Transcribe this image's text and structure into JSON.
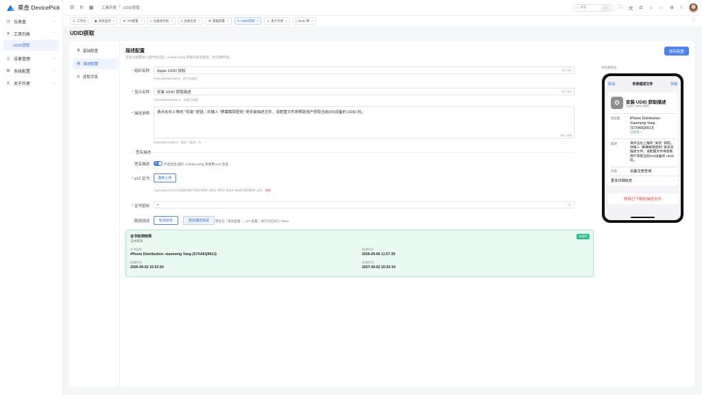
{
  "brand": {
    "name": "乘查 DevicePick"
  },
  "sidebar": {
    "items": [
      {
        "label": "仪表盘",
        "icon": "dashboard-icon",
        "glyph": "◷"
      },
      {
        "label": "工具列表",
        "icon": "tools-icon",
        "glyph": "✕"
      },
      {
        "label": "设备管理",
        "icon": "device-icon",
        "glyph": "▯"
      },
      {
        "label": "系统配置",
        "icon": "settings-icon",
        "glyph": "⚙"
      },
      {
        "label": "关于作者",
        "icon": "user-icon",
        "glyph": "♙"
      }
    ],
    "sub_item": "UDID获取"
  },
  "header": {
    "breadcrumb": [
      "工具列表",
      "UDID获取"
    ],
    "search_placeholder": "搜索",
    "search_shortcut": "⌘ K"
  },
  "tabs": [
    {
      "label": "工作台",
      "glyph": "◷",
      "closable": false
    },
    {
      "label": "系统监控",
      "glyph": "▣",
      "closable": true
    },
    {
      "label": "API配置",
      "glyph": "⚙",
      "closable": true
    },
    {
      "label": "设备组识别",
      "glyph": "▯",
      "closable": true
    },
    {
      "label": "设备信息",
      "glyph": "▯",
      "closable": true
    },
    {
      "label": "基础配置",
      "glyph": "⚙",
      "closable": true
    },
    {
      "label": "UDID获取",
      "glyph": "✕",
      "closable": true,
      "active": true
    },
    {
      "label": "关于作者",
      "glyph": "♙",
      "closable": true
    },
    {
      "label": "Bx3d 尊",
      "glyph": "▯",
      "closable": true
    }
  ],
  "page": {
    "title": "UDID获取"
  },
  "subnav": [
    {
      "label": "基础配置",
      "glyph": "⚙"
    },
    {
      "label": "描述配置",
      "glyph": "▤",
      "active": true
    },
    {
      "label": "提取字段",
      "glyph": "◎"
    }
  ],
  "form": {
    "section_title": "描述配置",
    "section_desc": "自定义配置导入后时生成的 .mobileconfig 的额外安装预览，所见即所得。",
    "save_label": "保存配置",
    "org_label": "组织名称",
    "org_value": "Apple UDID 授权",
    "org_count": "13 / 64",
    "org_hint": "PayloadOrganization · 用户的组织",
    "display_label": "显示名称",
    "display_value": "安装 UDID 获取描述",
    "display_count": "12 / 64",
    "display_hint": "PayloadDisplayName · 标题主标题",
    "desc_label": "描述说明",
    "desc_value": "请点击右上角的 \"安装\" 按钮。并输入 \"屏幕解锁密码\" 来安装描述文件，该配置文件将帮助用户获取当前iOS设备的 UDID 码。",
    "desc_count": "65 / 300",
    "desc_hint": "PayloadDescription · 描述（描述）内",
    "sign_divider": "签名描述",
    "sign_label": "签名描述",
    "sign_toggle_on": "开",
    "sign_toggle_text": "开启后生成的 .mobileconfig 将使用 p12 签名",
    "p12_label": "p12 证书",
    "p12_button": "重新上传",
    "p12_path": "/uploads/certs/2026/09/f43ef694-345a-4951-8ce4-e0a9c3658041.p12",
    "p12_remove": "移除",
    "pwd_label": "证书密码",
    "pwd_value": "•",
    "test_label": "联调测试",
    "test_btn1": "检测状态",
    "test_btn2": "签名描述测试",
    "test_hint": "需先在「系统配置 → API 配置」填写对应接口 Token"
  },
  "cert_result": {
    "title": "证书检测结果",
    "subtitle": "证书有效",
    "badge": "有效中",
    "name_key": "证书名称",
    "name_val": "iPhone Distribution: xiaomeng Yang (S7XA6Q99JJ)",
    "check_key": "检测时间",
    "check_val": "2026-09-06 11:57:35",
    "created_key": "创建时间",
    "created_val": "2026-09-02 15:02:20",
    "expire_key": "失效时间",
    "expire_val": "2027-09-02 15:02:19"
  },
  "preview": {
    "label": "手机端预览",
    "nav_cancel": "取消",
    "nav_title": "安装描述文件",
    "nav_install": "安装",
    "profile_title": "安装 UDID 获取描述",
    "profile_sub": "Apple UDID 授权",
    "signer_key": "签名者",
    "signer_val": "iPhone Distribution: Xiaomeng Yang (S7XA6Q99JJ)",
    "signer_verified": "已验证 ✓",
    "desc_key": "描述",
    "desc_val": "请点击右上角的 \"安装\" 按钮。并输入 \"屏幕解锁密码\" 来安装描述文件。该配置文件将帮助用户获取当前iOS设备的 UDID 码。",
    "contains_key": "包含",
    "contains_val": "设备注册查询",
    "more_label": "更多详细信息",
    "remove_label": "移除已下载的描述文件"
  }
}
